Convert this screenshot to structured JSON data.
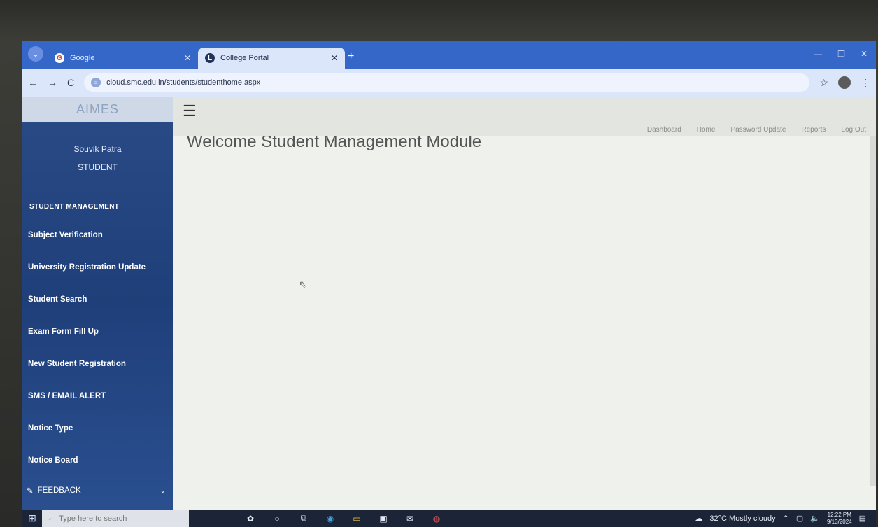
{
  "browser": {
    "tabs": [
      {
        "label": "Google",
        "icon": "google-icon",
        "active": false
      },
      {
        "label": "College Portal",
        "icon": "portal-icon",
        "active": true
      }
    ],
    "url": "cloud.smc.edu.in/students/studenthome.aspx"
  },
  "sidebar": {
    "logo_text": "AIMES",
    "user_name": "Souvik Patra",
    "user_role": "STUDENT",
    "section_title": "STUDENT MANAGEMENT",
    "items": [
      {
        "label": "Subject Verification"
      },
      {
        "label": "University Registration Update"
      },
      {
        "label": "Student Search"
      },
      {
        "label": "Exam Form Fill Up"
      },
      {
        "label": "New Student Registration"
      },
      {
        "label": "SMS / EMAIL ALERT"
      },
      {
        "label": "Notice Type"
      },
      {
        "label": "Notice Board"
      }
    ],
    "feedback_label": "FEEDBACK"
  },
  "topnav": {
    "links": [
      {
        "label": "Dashboard"
      },
      {
        "label": "Home"
      },
      {
        "label": "Password Update"
      },
      {
        "label": "Reports"
      },
      {
        "label": "Log Out"
      }
    ]
  },
  "main": {
    "welcome": "Welcome Student Management Module"
  },
  "taskbar": {
    "search_placeholder": "Type here to search",
    "weather": "32°C  Mostly cloudy",
    "time": "12:22 PM",
    "date": "9/13/2024"
  }
}
